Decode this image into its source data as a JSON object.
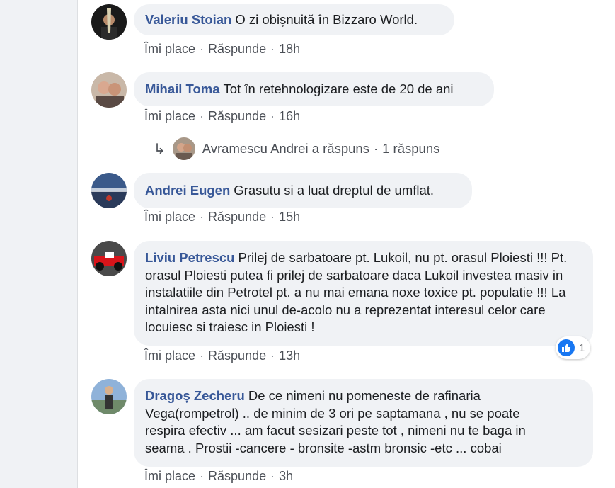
{
  "actions": {
    "like_label": "Îmi place",
    "reply_label": "Răspunde",
    "separator": "·"
  },
  "comments": [
    {
      "author": "Valeriu Stoian",
      "text": "O zi obișnuită în Bizzaro World.",
      "time": "18h"
    },
    {
      "author": "Mihail Toma",
      "text": "Tot în retehnologizare este de 20 de ani",
      "time": "16h"
    },
    {
      "author": "Andrei Eugen",
      "text": "Grasutu si a luat dreptul de umflat.",
      "time": "15h"
    },
    {
      "author": "Liviu Petrescu",
      "text": "Prilej de sarbatoare pt. Lukoil, nu pt. orasul Ploiesti !!! Pt. orasul Ploiesti putea fi prilej de sarbatoare daca Lukoil investea masiv in instalatiile din Petrotel pt. a nu mai emana noxe toxice pt. populatie !!! La intalnirea asta nici unul de-acolo nu a reprezentat interesul celor care locuiesc si traiesc in Ploiesti !",
      "time": "13h",
      "reaction": {
        "icon": "thumbs-up-icon",
        "count": "1"
      }
    },
    {
      "author": "Dragoș Zecheru",
      "text": "De ce nimeni nu pomeneste de rafinaria Vega(rompetrol) .. de minim de 3 ori pe saptamana , nu se poate respira efectiv ... am facut sesizari peste tot , nimeni nu te baga in seama . Prostii -cancere - bronsite -astm bronsic -etc ... cobai",
      "time": "3h"
    }
  ],
  "reply_summary": {
    "arrow_icon": "reply-arrow-icon",
    "text": "Avramescu Andrei a răspuns",
    "separator": "·",
    "count": "1 răspuns"
  },
  "colors": {
    "author": "#385898",
    "bubble": "#f0f2f5",
    "like_blue": "#1877f2"
  }
}
